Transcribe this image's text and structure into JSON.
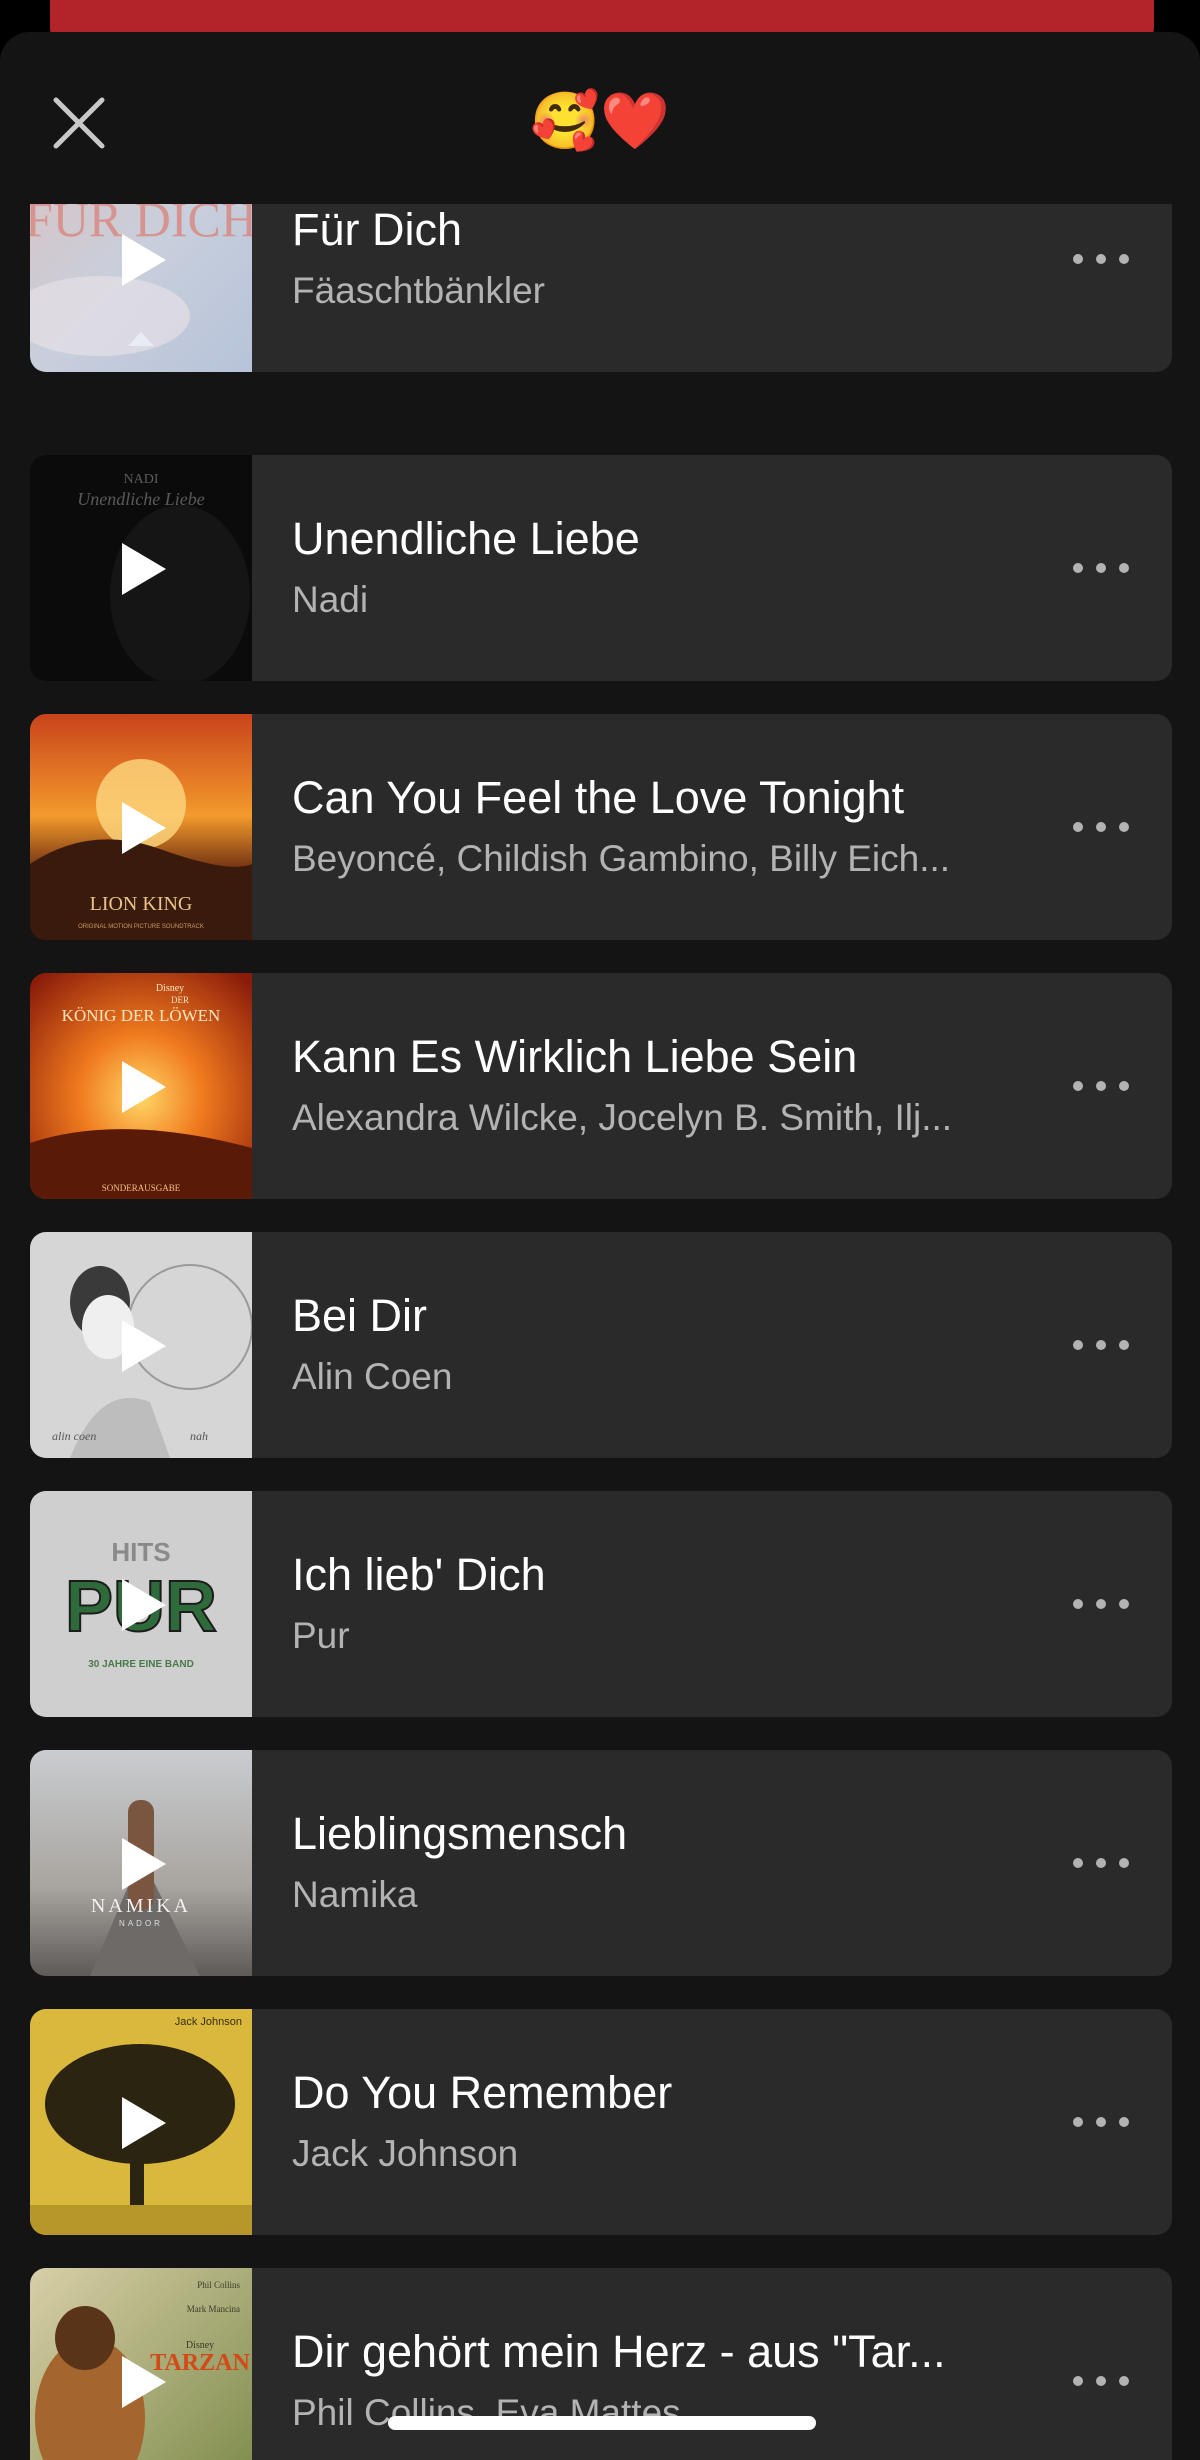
{
  "header": {
    "title": "🥰❤️",
    "close_icon": "close-icon"
  },
  "colors": {
    "background": "#000000",
    "sheet": "#141414",
    "card": "#2a2a2a",
    "title_text": "#ffffff",
    "artist_text": "#b3b3b3",
    "peek_bar": "#b3242a"
  },
  "tracks": [
    {
      "title": "Für Dich",
      "artist": "Fäaschtbänkler",
      "cover": "fur-dich-cover"
    },
    {
      "title": "Unendliche Liebe",
      "artist": "Nadi",
      "cover": "unendliche-liebe-cover"
    },
    {
      "title": "Can You Feel the Love Tonight",
      "artist": "Beyoncé, Childish Gambino, Billy Eich...",
      "cover": "lion-king-cover"
    },
    {
      "title": "Kann Es Wirklich Liebe Sein",
      "artist": "Alexandra Wilcke, Jocelyn B. Smith, Ilj...",
      "cover": "konig-der-lowen-cover"
    },
    {
      "title": "Bei Dir",
      "artist": "Alin Coen",
      "cover": "bei-dir-cover"
    },
    {
      "title": "Ich lieb' Dich",
      "artist": "Pur",
      "cover": "pur-hits-cover"
    },
    {
      "title": "Lieblingsmensch",
      "artist": "Namika",
      "cover": "namika-cover"
    },
    {
      "title": "Do You Remember",
      "artist": "Jack Johnson",
      "cover": "jack-johnson-cover"
    },
    {
      "title": "Dir gehört mein Herz - aus \"Tar...",
      "artist": "Phil Collins, Eva Mattes",
      "cover": "tarzan-cover"
    }
  ],
  "cover_text": {
    "fur_dich": "FÜR DICH",
    "nadi": "NADI",
    "nadi_script": "Unendliche Liebe",
    "lion_king": "LION KING",
    "lion_king_sub": "ORIGINAL MOTION PICTURE SOUNDTRACK",
    "konig_brand": "Disney",
    "konig_der": "DER",
    "konig_title": "KÖNIG DER LÖWEN",
    "konig_sub": "SONDERAUSGABE",
    "alin_left": "alin coen",
    "alin_right": "nah",
    "pur_hits": "HITS",
    "pur_logo": "PUR",
    "pur_sub": "30 JAHRE EINE BAND",
    "namika": "NAMIKA",
    "namika_sub": "NADOR",
    "jack": "Jack Johnson",
    "tarzan_brand": "Disney",
    "tarzan": "TARZAN",
    "phil": "Phil Collins",
    "mark": "Mark Mancina"
  }
}
